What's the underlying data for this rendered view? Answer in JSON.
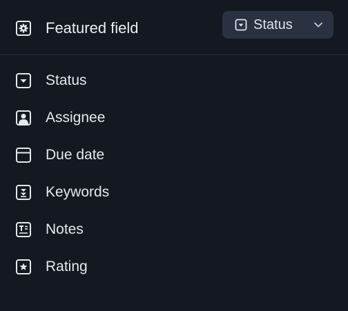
{
  "header": {
    "label": "Featured field",
    "icon": "gear-box-icon"
  },
  "dropdown": {
    "selected": "Status",
    "icon": "dropdown-box-icon",
    "chevron": "chevron-down-icon"
  },
  "fields": [
    {
      "label": "Status",
      "icon": "dropdown-box-icon"
    },
    {
      "label": "Assignee",
      "icon": "person-box-icon"
    },
    {
      "label": "Due date",
      "icon": "calendar-box-icon"
    },
    {
      "label": "Keywords",
      "icon": "tags-box-icon"
    },
    {
      "label": "Notes",
      "icon": "text-box-icon"
    },
    {
      "label": "Rating",
      "icon": "star-box-icon"
    }
  ],
  "colors": {
    "background": "#141821",
    "dropdown_bg": "#2a3140",
    "text": "#e6e8ed",
    "divider": "#232834"
  }
}
